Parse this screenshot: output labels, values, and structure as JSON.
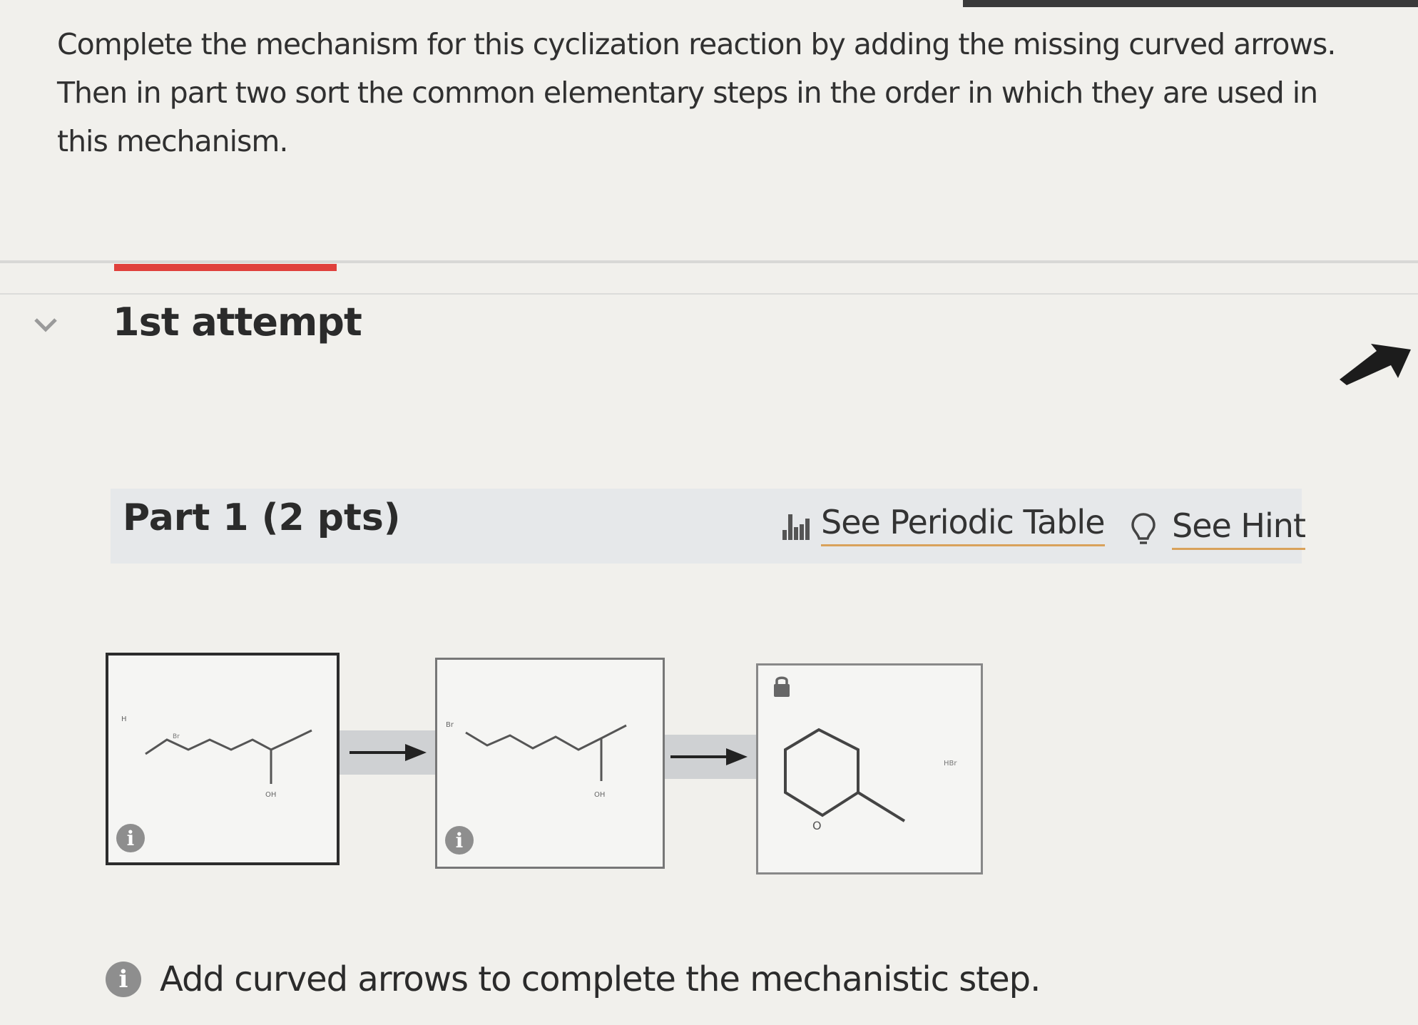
{
  "question": {
    "text": "Complete the mechanism for this cyclization reaction by adding the missing curved arrows. Then in part two sort the common elementary steps in the order in which they are used in this mechanism."
  },
  "attempt": {
    "title": "1st attempt"
  },
  "part": {
    "title": "Part 1 (2 pts)",
    "periodic_table_label": "See Periodic Table",
    "hint_label": "See Hint"
  },
  "mechanism": {
    "info_badge": "i",
    "lock_icon": "lock-icon"
  },
  "feedback": {
    "info_badge": "i",
    "message": "Add curved arrows to complete the mechanistic step."
  },
  "colors": {
    "accent_red": "#e0403c",
    "link_underline": "#d9a25b",
    "badge_gray": "#8e8e8e"
  }
}
